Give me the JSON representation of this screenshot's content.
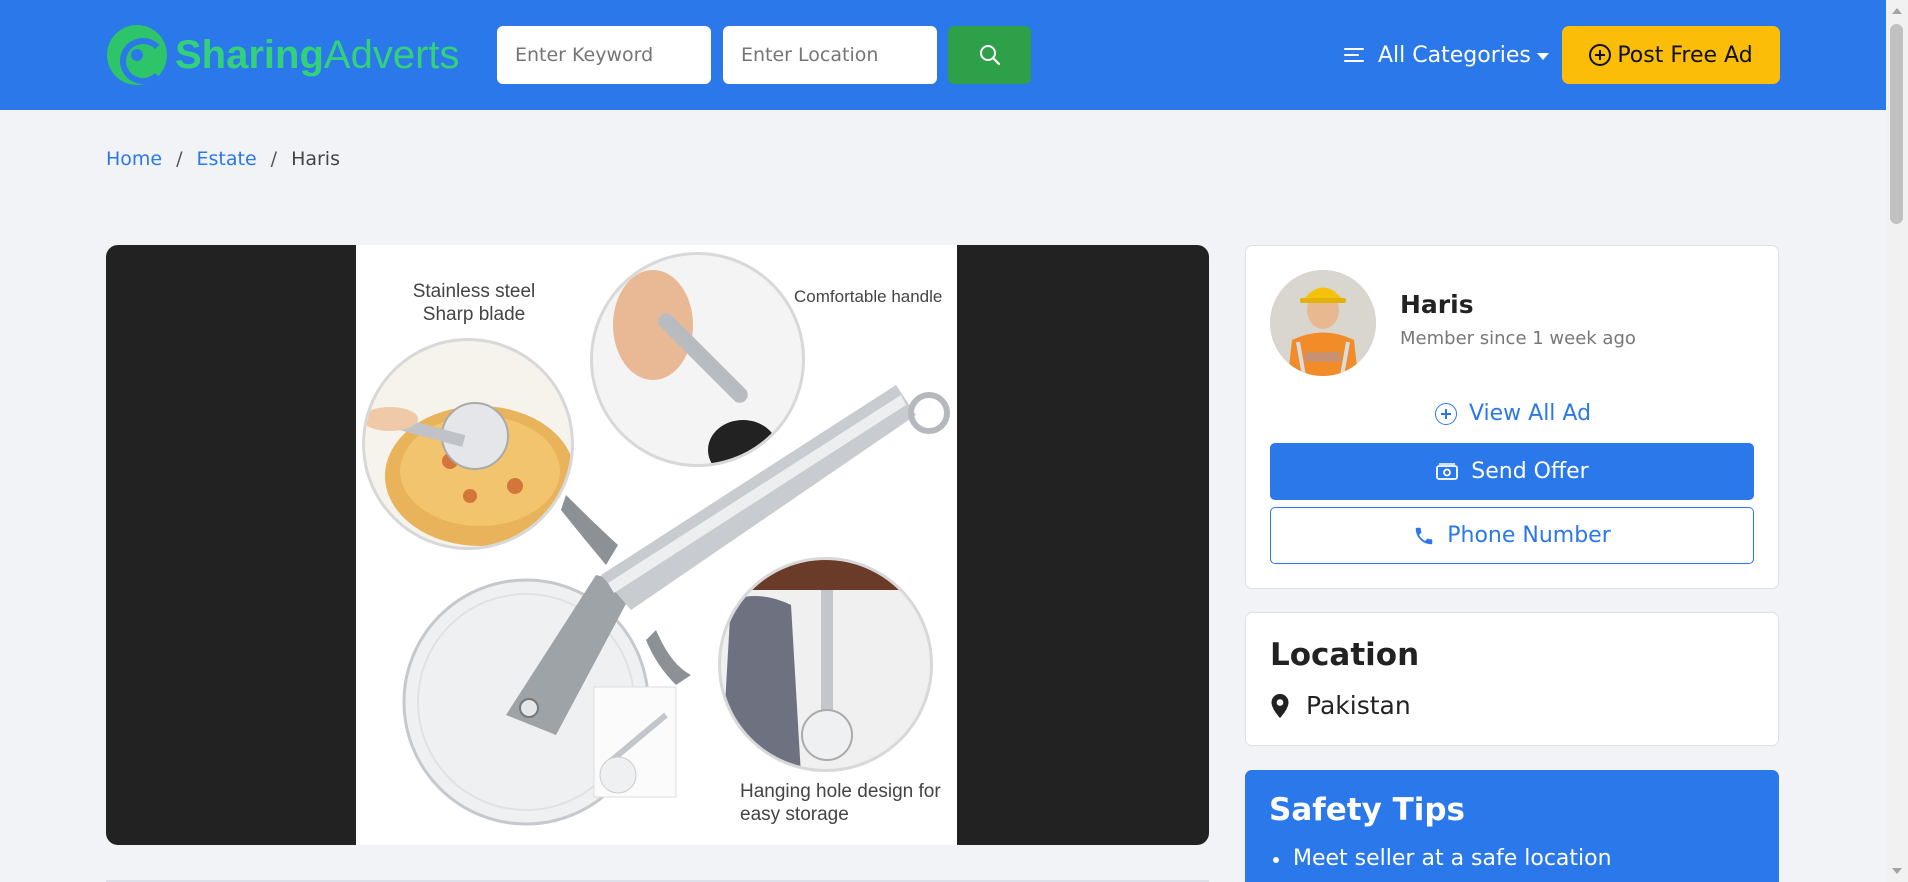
{
  "header": {
    "logo_part1": "Sharing",
    "logo_part2": "Adverts",
    "keyword_placeholder": "Enter Keyword",
    "location_placeholder": "Enter Location",
    "categories_label": "All Categories",
    "post_ad_label": "Post Free Ad"
  },
  "breadcrumb": {
    "home": "Home",
    "category": "Estate",
    "current": "Haris",
    "separator": "/"
  },
  "product_image": {
    "caption_blade_1": "Stainless steel",
    "caption_blade_2": "Sharp blade",
    "caption_handle": "Comfortable handle",
    "caption_hanging_1": "Hanging hole design for",
    "caption_hanging_2": "easy storage"
  },
  "seller": {
    "name": "Haris",
    "member_since": "Member since 1 week ago",
    "view_all_label": "View All Ad",
    "send_offer_label": "Send Offer",
    "phone_label": "Phone Number"
  },
  "location": {
    "title": "Location",
    "value": "Pakistan"
  },
  "safety": {
    "title": "Safety Tips",
    "tips": [
      "Meet seller at a safe location"
    ]
  },
  "colors": {
    "primary": "#2b78ea",
    "logo_green": "#33d17a",
    "search_green": "#2fa04a",
    "post_yellow": "#fbbd08",
    "background": "#f1f3f7"
  }
}
